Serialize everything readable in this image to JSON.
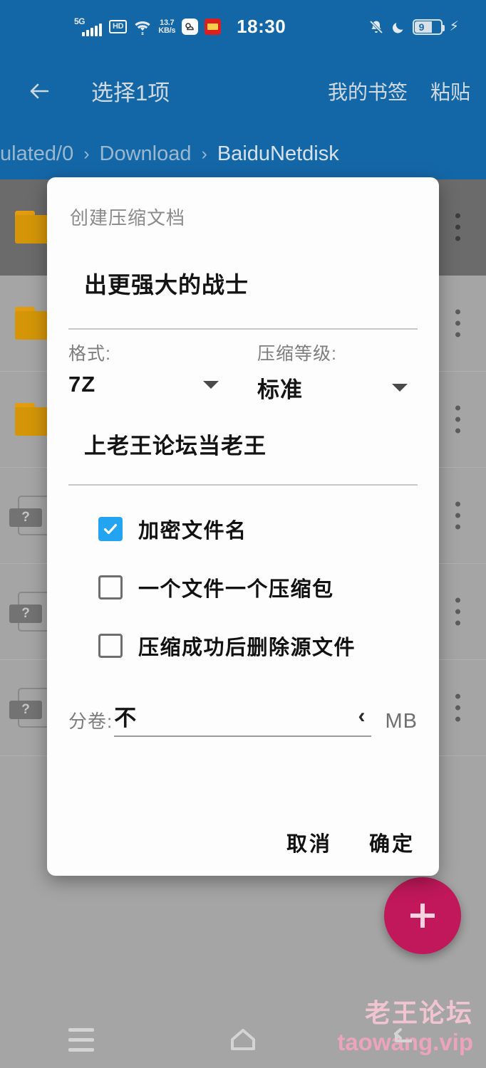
{
  "status_bar": {
    "network_type": "5G",
    "hd_label": "HD",
    "data_rate_value": "13.7",
    "data_rate_unit": "KB/s",
    "clock": "18:30",
    "battery_level": "9",
    "icons": [
      "signal-bars-icon",
      "hd-icon",
      "wifi-icon",
      "data-rate-icon",
      "app-icon-white",
      "app-icon-red",
      "bell-muted-icon",
      "moon-icon",
      "battery-icon",
      "charging-bolt-icon"
    ],
    "bg_color": "#156aab"
  },
  "app_bar": {
    "back_label": "back-arrow",
    "title": "选择1项",
    "actions": [
      {
        "label": "我的书签"
      },
      {
        "label": "粘贴"
      }
    ]
  },
  "breadcrumb": {
    "segments": [
      "ulated/0",
      "Download",
      "BaiduNetdisk"
    ],
    "separator": "›"
  },
  "file_list": {
    "rows": [
      {
        "type": "folder",
        "selected": true
      },
      {
        "type": "folder",
        "selected": false
      },
      {
        "type": "folder",
        "selected": false
      },
      {
        "type": "file",
        "badge": "?",
        "selected": false
      },
      {
        "type": "file",
        "badge": "?",
        "selected": false
      },
      {
        "type": "file",
        "badge": "?",
        "selected": false
      }
    ],
    "overflow_icon": "more-vertical-icon"
  },
  "fab": {
    "icon": "plus-icon",
    "color": "#c4195c"
  },
  "watermark": {
    "line1": "老王论坛",
    "line2": "taowang.vip"
  },
  "nav_bar": {
    "items": [
      "recents-icon",
      "home-icon",
      "back-icon"
    ]
  },
  "dialog": {
    "title": "创建压缩文档",
    "archive_name": "出更强大的战士",
    "format": {
      "label": "格式:",
      "value": "7Z",
      "caret": "chevron-down-icon"
    },
    "level": {
      "label": "压缩等级:",
      "value": "标准",
      "caret": "chevron-down-icon"
    },
    "password": {
      "value": "上老王论坛当老王"
    },
    "checkboxes": [
      {
        "label": "加密文件名",
        "checked": true
      },
      {
        "label": "一个文件一个压缩包",
        "checked": false
      },
      {
        "label": "压缩成功后删除源文件",
        "checked": false
      }
    ],
    "split": {
      "label": "分卷:",
      "value": "不",
      "chevron": "‹",
      "unit": "MB"
    },
    "buttons": {
      "cancel": "取消",
      "confirm": "确定"
    },
    "accent_color": "#23a4f0"
  }
}
